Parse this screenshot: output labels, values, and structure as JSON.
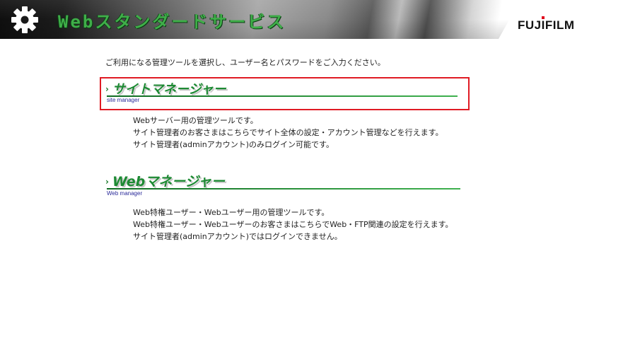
{
  "header": {
    "title": "Webスタンダードサービス",
    "brand": "FUJIFILM",
    "gear_icon": "gear-icon",
    "title_color": "#3fae49"
  },
  "intro": "ご利用になる管理ツールを選択し、ユーザー名とパスワードをご入力ください。",
  "site_manager": {
    "arrow": "›",
    "title": "サイトマネージャー",
    "subtitle": "site manager",
    "highlighted": true,
    "highlight_color": "#e01b24",
    "description": [
      "Webサーバー用の管理ツールです。",
      "サイト管理者のお客さまはこちらでサイト全体の設定・アカウント管理などを行えます。",
      "サイト管理者(adminアカウント)のみログイン可能です。"
    ]
  },
  "web_manager": {
    "arrow": "›",
    "title": "Webマネージャー",
    "subtitle": "Web manager",
    "description": [
      "Web特権ユーザー・Webユーザー用の管理ツールです。",
      "Web特権ユーザー・Webユーザーのお客さまはこちらでWeb・FTP関連の設定を行えます。",
      "サイト管理者(adminアカウント)ではログインできません。"
    ]
  }
}
